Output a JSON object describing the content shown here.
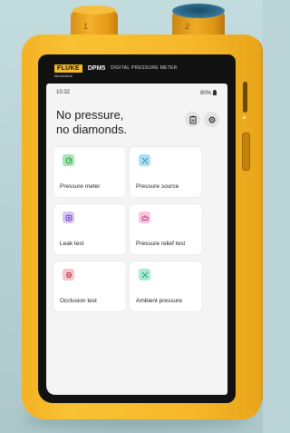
{
  "ports": {
    "port1_label": "1",
    "port2_label": "2"
  },
  "device": {
    "brand_logo": "FLUKE",
    "model": "DPM5",
    "description": "DIGITAL PRESSURE METER",
    "sub_brand": "Biomedical"
  },
  "status_bar": {
    "time": "10:32",
    "battery": "80%"
  },
  "main": {
    "heading_line1": "No pressure,",
    "heading_line2": "no diamonds.",
    "report_icon": "clipboard-icon",
    "settings_icon": "gear-icon"
  },
  "tiles": [
    {
      "label": "Pressure meter",
      "icon": "gauge-icon",
      "color": "#a9e6b3",
      "icon_color": "#2f9a45"
    },
    {
      "label": "Pressure source",
      "icon": "pump-icon",
      "color": "#aedff5",
      "icon_color": "#2a8ab5"
    },
    {
      "label": "Leak test",
      "icon": "leak-icon",
      "color": "#d6c6f4",
      "icon_color": "#7045c2"
    },
    {
      "label": "Pressure relief test",
      "icon": "relief-icon",
      "color": "#f6c6de",
      "icon_color": "#c43a82"
    },
    {
      "label": "Occlusion test",
      "icon": "occlusion-icon",
      "color": "#f7c6cc",
      "icon_color": "#c43646"
    },
    {
      "label": "Ambient pressure",
      "icon": "ambient-icon",
      "color": "#a9ecd6",
      "icon_color": "#2a9d78"
    }
  ],
  "colors": {
    "device_yellow": "#f8c232",
    "bezel": "#121212",
    "screen": "#f4f4f4",
    "background": "#b9d3d6"
  }
}
